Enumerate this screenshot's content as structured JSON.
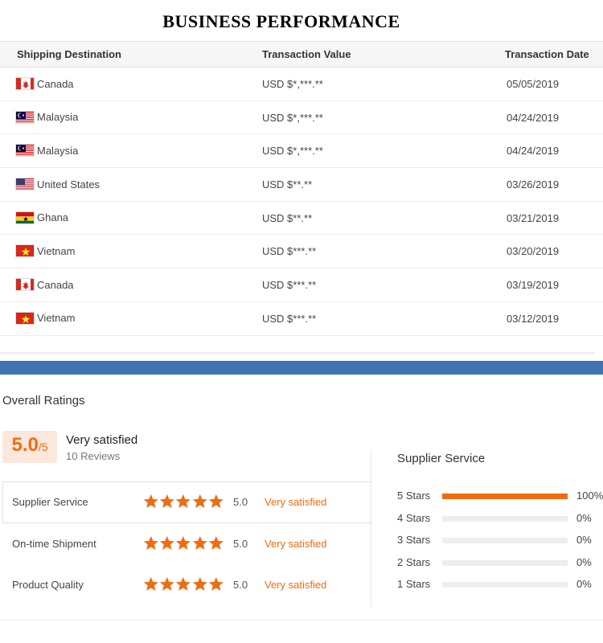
{
  "page": {
    "title": "BUSINESS PERFORMANCE"
  },
  "transactions": {
    "headers": {
      "destination": "Shipping Destination",
      "value": "Transaction Value",
      "date": "Transaction Date"
    },
    "rows": [
      {
        "country": "Canada",
        "flag": "canada-flag-icon",
        "value": "USD $*,***.**",
        "date": "05/05/2019"
      },
      {
        "country": "Malaysia",
        "flag": "malaysia-flag-icon",
        "value": "USD $*,***.**",
        "date": "04/24/2019"
      },
      {
        "country": "Malaysia",
        "flag": "malaysia-flag-icon",
        "value": "USD $*,***.**",
        "date": "04/24/2019"
      },
      {
        "country": "United States",
        "flag": "usa-flag-icon",
        "value": "USD $**.**",
        "date": "03/26/2019"
      },
      {
        "country": "Ghana",
        "flag": "ghana-flag-icon",
        "value": "USD $**.**",
        "date": "03/21/2019"
      },
      {
        "country": "Vietnam",
        "flag": "vietnam-flag-icon",
        "value": "USD $***.**",
        "date": "03/20/2019"
      },
      {
        "country": "Canada",
        "flag": "canada-flag-icon",
        "value": "USD $***.**",
        "date": "03/19/2019"
      },
      {
        "country": "Vietnam",
        "flag": "vietnam-flag-icon",
        "value": "USD $***.**",
        "date": "03/12/2019"
      }
    ]
  },
  "ratings": {
    "title": "Overall Ratings",
    "score": "5.0",
    "score_max": "/5",
    "score_label": "Very satisfied",
    "reviews": "10 Reviews",
    "categories": [
      {
        "name": "Supplier Service",
        "stars": 5,
        "score": "5.0",
        "label": "Very satisfied"
      },
      {
        "name": "On-time Shipment",
        "stars": 5,
        "score": "5.0",
        "label": "Very satisfied"
      },
      {
        "name": "Product Quality",
        "stars": 5,
        "score": "5.0",
        "label": "Very satisfied"
      }
    ],
    "distribution": {
      "title": "Supplier Service",
      "rows": [
        {
          "label": "5 Stars",
          "percent": 100,
          "percent_text": "100%"
        },
        {
          "label": "4 Stars",
          "percent": 0,
          "percent_text": "0%"
        },
        {
          "label": "3 Stars",
          "percent": 0,
          "percent_text": "0%"
        },
        {
          "label": "2 Stars",
          "percent": 0,
          "percent_text": "0%"
        },
        {
          "label": "1 Stars",
          "percent": 0,
          "percent_text": "0%"
        }
      ]
    }
  },
  "colors": {
    "accent": "#f06c12",
    "accent_light": "#fce7dc",
    "band_blue": "#3f74b3",
    "bar_track": "#eeeeee"
  }
}
